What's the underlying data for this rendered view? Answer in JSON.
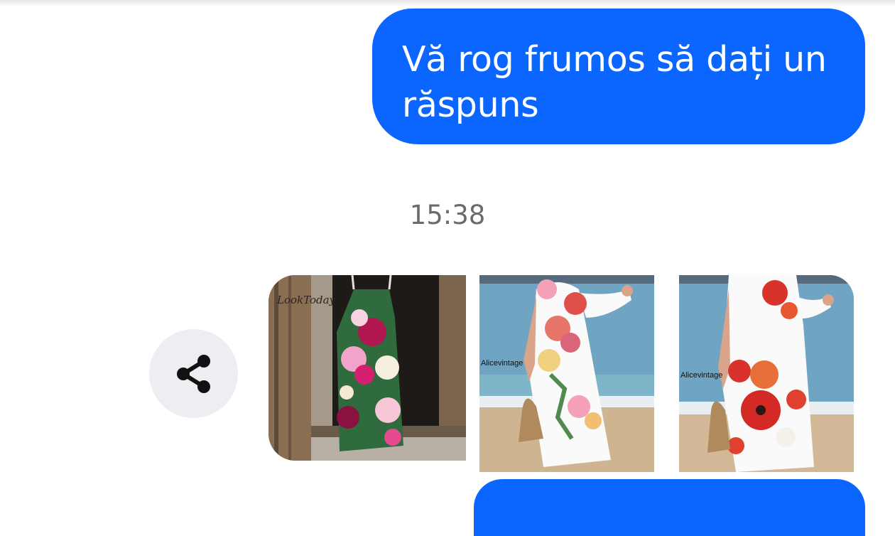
{
  "conversation": {
    "outgoing_message": "Vă rog frumos să dați un\nrăspuns",
    "timestamp": "15:38"
  },
  "share": {
    "icon": "share-icon"
  },
  "photos": [
    {
      "watermark": "LookToday",
      "description": "floral overalls hanging on old wooden door"
    },
    {
      "watermark": "Alicevintage",
      "description": "white floral dress on beach with straw bag"
    },
    {
      "watermark": "Alicevintage",
      "description": "white dress with red poppies on beach"
    }
  ],
  "colors": {
    "bubble": "#0a66ff",
    "bubble_text": "#ffffff",
    "timestamp": "#6b6b6b",
    "share_bg": "#eceef1"
  }
}
